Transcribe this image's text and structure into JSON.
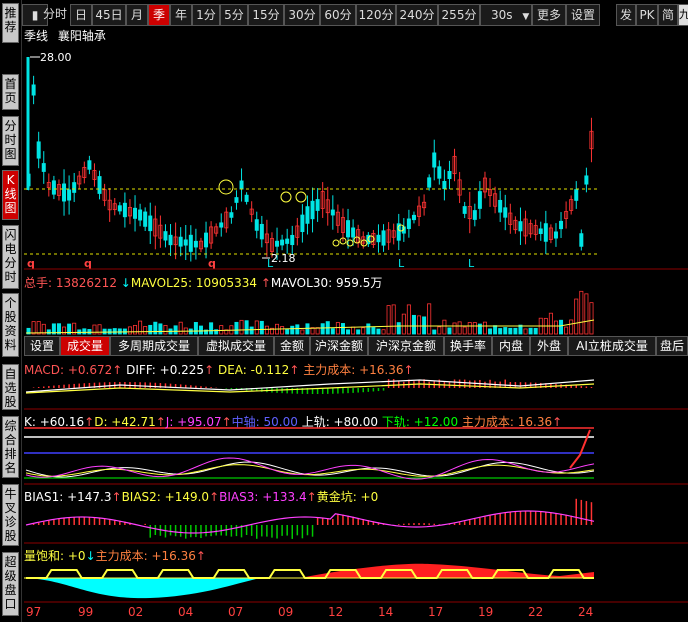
{
  "toolbar": {
    "items": [
      "分时",
      "日",
      "45日",
      "月",
      "季",
      "年",
      "1分",
      "5分",
      "15分",
      "30分",
      "60分",
      "120分",
      "240分",
      "255分",
      "30s",
      "更多",
      "设置",
      "发",
      "PK",
      "简",
      "九"
    ],
    "active": "季"
  },
  "sidebar": {
    "items": [
      "推荐",
      "首页",
      "分时图",
      "K线图",
      "闪电分时",
      "个股资料",
      "自选股",
      "综合排名",
      "牛叉诊股",
      "超级盘口"
    ],
    "active": "K线图"
  },
  "chart_title": {
    "period": "季线",
    "stock": "襄阳轴承"
  },
  "price": {
    "high_label": "28.00",
    "low_label": "2.18",
    "markers": [
      "q",
      "q",
      "q",
      "L",
      "L",
      "L"
    ]
  },
  "volume": {
    "label_total": "总手:",
    "total": "13826212",
    "label_mavol25": "MAVOL25:",
    "mavol25": "10905334",
    "label_mavol30": "MAVOL30:",
    "mavol30": "959.5万"
  },
  "tabs": {
    "items": [
      "设置",
      "成交量",
      "多周期成交量",
      "虚拟成交量",
      "金额",
      "沪深金额",
      "沪深京金额",
      "换手率",
      "内盘",
      "外盘",
      "AI立桩成交量",
      "盘后"
    ],
    "active": "成交量"
  },
  "macd": {
    "macd": "MACD: +0.672",
    "diff": "DIFF: +0.225",
    "dea": "DEA: -0.112",
    "cost": "主力成本: +16.36"
  },
  "kdj": {
    "k": "K: +60.16",
    "d": "D: +42.71",
    "j": "J: +95.07",
    "mid": "中轴: 50.00",
    "upper": "上轨: +80.00",
    "lower": "下轨: +12.00",
    "cost": "主力成本: 16.36"
  },
  "bias": {
    "bias1": "BIAS1: +147.3",
    "bias2": "BIAS2: +149.0",
    "bias3": "BIAS3: +133.4",
    "gold": "黄金坑: +0"
  },
  "saturation": {
    "label": "量饱和: +0",
    "cost": "主力成本: +16.36"
  },
  "xaxis": [
    "97",
    "99",
    "02",
    "04",
    "07",
    "09",
    "12",
    "14",
    "17",
    "19",
    "22",
    "24"
  ],
  "colors": {
    "up": "#ff3333",
    "down": "#00e5e5",
    "dash": "#e0e000",
    "accent": "#c00000"
  }
}
